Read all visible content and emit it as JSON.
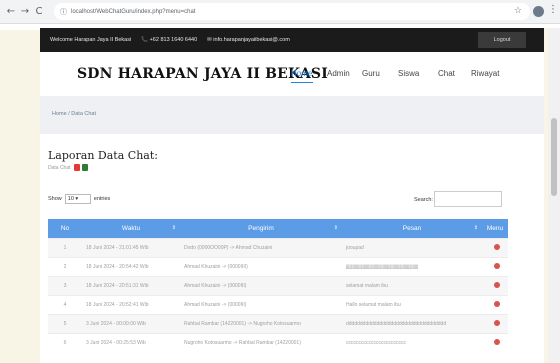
{
  "browser": {
    "back": "←",
    "forward": "→",
    "reload": "C",
    "info": "ⓘ",
    "url": "localhost/WebChatGuru/index.php?menu=chat",
    "star": "☆",
    "menu": "⋮"
  },
  "topbar": {
    "welcome": "Welcome Harapan Jaya II Bekasi",
    "phone": "📞 +62 813 1640 6440",
    "email": "✉ info.harapanjayaiibekasi@.com",
    "logout": "Logout"
  },
  "header": {
    "brand": "SDN HARAPAN JAYA II BEKASI",
    "nav": [
      {
        "label": "Home"
      },
      {
        "label": "Admin"
      },
      {
        "label": "Guru"
      },
      {
        "label": "Siswa"
      },
      {
        "label": "Chat"
      },
      {
        "label": "Riwayat"
      }
    ]
  },
  "breadcrumb": "Home / Data Chat",
  "report": {
    "title": "Laporan Data Chat:",
    "subtitle": "Data Chat"
  },
  "table_controls": {
    "show": "Show",
    "length": "10",
    "entries": "entries",
    "search": "Search:"
  },
  "table": {
    "headers": [
      "No",
      "Waktu",
      "Pengirim",
      "Pesan",
      "Menu"
    ],
    "rows": [
      {
        "no": "1",
        "waktu": "18 Juni 2024 - 21:01:45 Wib",
        "pengirim": "Dodo (0000OO00P) -> Ahmad Chuzaini",
        "pesan": "jooupad"
      },
      {
        "no": "2",
        "waktu": "18 Juni 2024 - 20:54:42 Wib",
        "pengirim": "Ahmad Khuzaini -> (0000IIII)",
        "pesan": "jjjjjjjjjjjjjjjjjjjjjjjjjjjjjjjjjjjjjjjjjjjjjjjjjjjjjjjjjjjjjjjjj"
      },
      {
        "no": "3",
        "waktu": "18 Juni 2024 - 20:51:31 Wib",
        "pengirim": "Ahmad Khuzaini -> (0000III)",
        "pesan": "selamat malam ibu"
      },
      {
        "no": "4",
        "waktu": "18 Juni 2024 - 20:52:41 Wib",
        "pengirim": "Ahmad Khuzaini -> (0000III)",
        "pesan": "Hallo selamat malam ibu"
      },
      {
        "no": "5",
        "waktu": "3 Juni 2024 - 00:00:00 Wib",
        "pengirim": "Rahbal Rambar (14220001) -> Nugroho Kotosuarmo",
        "pesan": "dddddddddddddddddddddddddddddddddddd"
      },
      {
        "no": "6",
        "waktu": "3 Juni 2024 - 00:25:53 Wib",
        "pengirim": "Nugroho Kotosuarmo -> Rahbal Rambar (14220001)",
        "pesan": "cccccccccccccccccccccccc"
      }
    ]
  },
  "colors": {
    "topbar": "#1b1b1b",
    "accent": "#1e88e5",
    "table_header": "#5c9ce6",
    "delete": "#d9534f"
  }
}
